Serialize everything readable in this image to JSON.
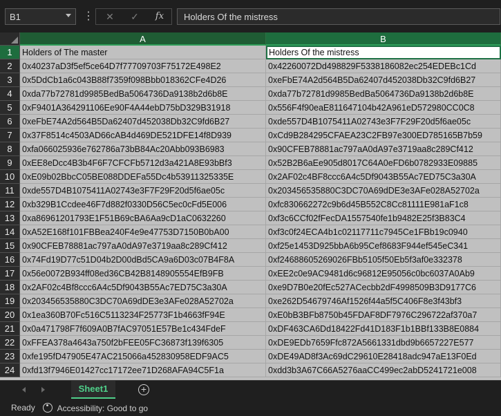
{
  "formula_bar": {
    "name_box": "B1",
    "cancel_icon": "close-icon",
    "enter_icon": "check-icon",
    "fx_label": "fx",
    "content": "Holders Of the mistress"
  },
  "columns": [
    "A",
    "B"
  ],
  "rows": [
    {
      "num": "1",
      "a": "Holders of The master",
      "b": "Holders Of the mistress"
    },
    {
      "num": "2",
      "a": "0x40237aD3f5ef5ce64D7f77709703F75172E498E2",
      "b": "0x42260072Dd498829F5338186082ec254EDEBc1Cd"
    },
    {
      "num": "3",
      "a": "0x5DdCb1a6c043B88f7359f098Bbb018362CFe4D26",
      "b": "0xeFbE74A2d564B5Da62407d452038Db32C9fd6B27"
    },
    {
      "num": "4",
      "a": "0xda77b72781d9985BedBa5064736Da9138b2d6b8E",
      "b": "0xda77b72781d9985BedBa5064736Da9138b2d6b8E"
    },
    {
      "num": "5",
      "a": "0xF9401A364291106Ee90F4A44ebD75bD329B31918",
      "b": "0x556F4f90eaE811647104b42A961eD572980CC0C8"
    },
    {
      "num": "6",
      "a": "0xeFbE74A2d564B5Da62407d452038Db32C9fd6B27",
      "b": "0xde557D4B1075411A02743e3F7F29F20d5f6ae05c"
    },
    {
      "num": "7",
      "a": "0x37F8514c4503AD66cAB4d469DE521DFE14f8D939",
      "b": "0xCd9B284295CFAEA23C2FB97e300ED785165B7b59"
    },
    {
      "num": "8",
      "a": "0xfa066025936e762786a73bB84Ac20Abb093B6983",
      "b": "0x90CFEB78881ac797aA0dA97e3719aa8c289Cf412"
    },
    {
      "num": "9",
      "a": "0xEE8eDcc4B3b4F6F7CFCFb5712d3a421A8E93bBf3",
      "b": "0x52B2B6aEe905d8017C64A0eFD6b0782933E09885"
    },
    {
      "num": "10",
      "a": "0xE09b02BbcC05BE088DDEFa55Dc4b53911325335E",
      "b": "0x2AF02c4BF8ccc6A4c5Df9043B55Ac7ED75C3a30A"
    },
    {
      "num": "11",
      "a": "0xde557D4B1075411A02743e3F7F29F20d5f6ae05c",
      "b": "0x203456535880C3DC70A69dDE3e3AFe028A52702a"
    },
    {
      "num": "12",
      "a": "0xb329B1Ccdee46F7d882f0330D56C5ec0cFd5E006",
      "b": "0xfc830662272c9b6d45B552C8Cc81111E981aF1c8"
    },
    {
      "num": "13",
      "a": "0xa86961201793E1F51B69cBA6Aa9cD1aC0632260",
      "b": "0xf3c6CCf02fFecDA1557540fe1b9482E25f3B83C4"
    },
    {
      "num": "14",
      "a": "0xA52E168f101FBBea240F4e9e47753D7150B0bA00",
      "b": "0xf3c0f24ECA4b1c02117711c7945Ce1FBb19c0940"
    },
    {
      "num": "15",
      "a": "0x90CFEB78881ac797aA0dA97e3719aa8c289Cf412",
      "b": "0xf25e1453D925bbA6b95Cef8683F944ef545eC341"
    },
    {
      "num": "16",
      "a": "0x74Fd19D77c51D04b2D00dBd5CA9a6D03c07B4F8A",
      "b": "0xf24688605269026FBb5105f50Eb5f3af0e332378"
    },
    {
      "num": "17",
      "a": "0x56e0072B934ff08ed36CB42B8148905554EfB9FB",
      "b": "0xEE2c0e9AC9481d6c96812E95056c0bc6037A0Ab9"
    },
    {
      "num": "18",
      "a": "0x2AF02c4Bf8ccc6A4c5Df9043B55Ac7ED75C3a30A",
      "b": "0xe9D7B0e20fEc527ACecbb2dF4998509B3D9177C6"
    },
    {
      "num": "19",
      "a": "0x203456535880C3DC70A69dDE3e3AFe028A52702a",
      "b": "0xe262D54679746Af1526f44a5f5C406F8e3f43bf3"
    },
    {
      "num": "20",
      "a": "0x1ea360B70Fc516C5113234F25773F1b4663fF94E",
      "b": "0xE0bB3BFb8750b45FDAF8DF7976C296722af370a7"
    },
    {
      "num": "21",
      "a": "0x0a471798F7f609A0B7fAC97051E57Be1c434FdeF",
      "b": "0xDF463CA6Dd18422Fd41D183F1b1BBf133B8E0884"
    },
    {
      "num": "22",
      "a": "0xFFEA378a4643a750f2bFEE05FC36873f139f6305",
      "b": "0xDE9EDb7659Ffc872A5661331dbd9b6657227E577"
    },
    {
      "num": "23",
      "a": "0xfe195fD47905E47AC215066a452830958EDF9AC5",
      "b": "0xDE49AD8f3Ac69dC29610E28418adc947aE13F0Ed"
    },
    {
      "num": "24",
      "a": "0xfd13f7946E01427cc17172ee71D268AFA94C5F1a",
      "b": "0xdd3b3A67C66A5276aaCC499ec2abD5241721e008"
    }
  ],
  "tabs": {
    "sheet_name": "Sheet1",
    "add_icon": "plus-circle-icon"
  },
  "status": {
    "ready": "Ready",
    "accessibility": "Accessibility: Good to go"
  },
  "colors": {
    "accent": "#1e7145",
    "sheet_tab": "#4fd08a"
  }
}
